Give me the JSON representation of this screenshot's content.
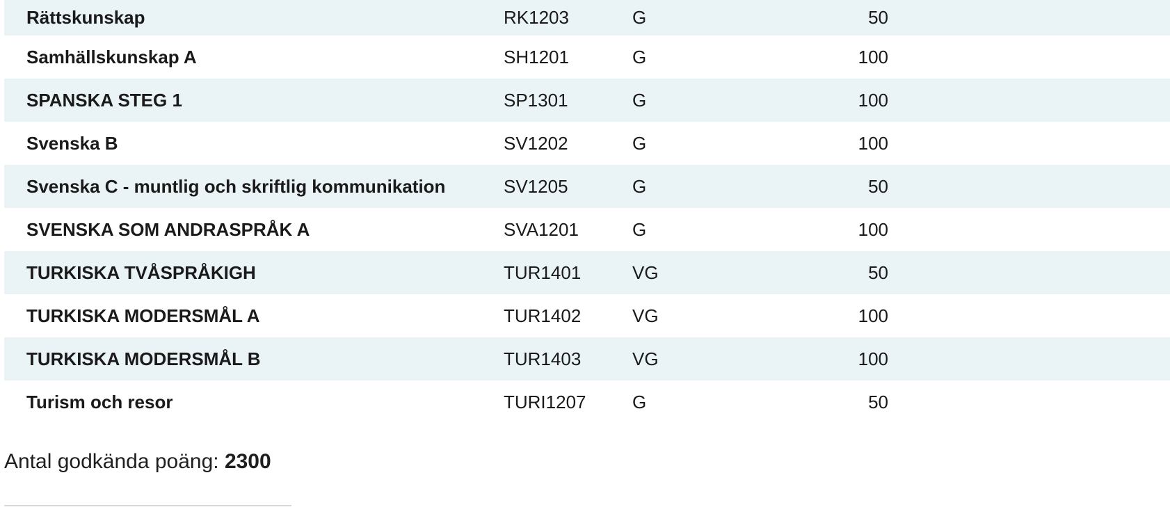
{
  "courses": [
    {
      "name": "Rättskunskap",
      "code": "RK1203",
      "grade": "G",
      "points": "50"
    },
    {
      "name": "Samhällskunskap A",
      "code": "SH1201",
      "grade": "G",
      "points": "100"
    },
    {
      "name": "SPANSKA STEG 1",
      "code": "SP1301",
      "grade": "G",
      "points": "100"
    },
    {
      "name": "Svenska B",
      "code": "SV1202",
      "grade": "G",
      "points": "100"
    },
    {
      "name": "Svenska C - muntlig och skriftlig kommunikation",
      "code": "SV1205",
      "grade": "G",
      "points": "50"
    },
    {
      "name": "SVENSKA SOM ANDRASPRÅK A",
      "code": "SVA1201",
      "grade": "G",
      "points": "100"
    },
    {
      "name": "TURKISKA TVÅSPRÅKIGH",
      "code": "TUR1401",
      "grade": "VG",
      "points": "50"
    },
    {
      "name": "TURKISKA MODERSMÅL A",
      "code": "TUR1402",
      "grade": "VG",
      "points": "100"
    },
    {
      "name": "TURKISKA MODERSMÅL B",
      "code": "TUR1403",
      "grade": "VG",
      "points": "100"
    },
    {
      "name": "Turism och resor",
      "code": "TURI1207",
      "grade": "G",
      "points": "50"
    }
  ],
  "summary": {
    "label": "Antal godkända poäng: ",
    "total": "2300"
  },
  "colors": {
    "row_stripe": "#eaf3f6",
    "row_plain": "#ffffff",
    "divider": "#d4d8da"
  }
}
